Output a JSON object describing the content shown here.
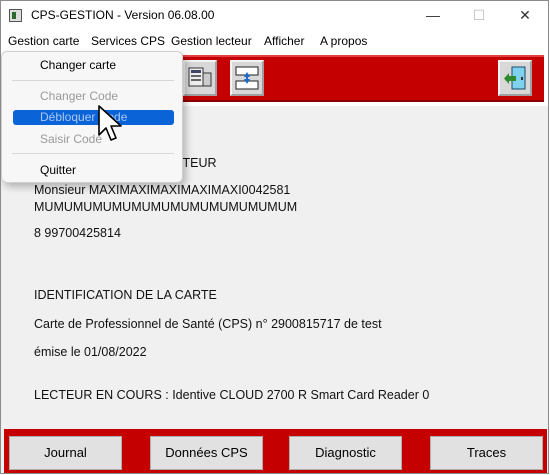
{
  "window": {
    "title": "CPS-GESTION - Version 06.08.00"
  },
  "controls": {
    "minimize": "—",
    "maximize": "☐",
    "close": "✕"
  },
  "menubar": [
    "Gestion carte",
    "Services CPS",
    "Gestion lecteur",
    "Afficher",
    "A propos"
  ],
  "dropdown": {
    "items": [
      {
        "label": "Changer carte",
        "enabled": true
      },
      {
        "label": "Changer Code",
        "enabled": false
      },
      {
        "label": "Débloquer Code",
        "enabled": false,
        "highlighted": true
      },
      {
        "label": "Saisir Code",
        "enabled": false
      },
      {
        "label": "Quitter",
        "enabled": true
      }
    ]
  },
  "toolbar": {
    "icons": [
      "card-reader-icon",
      "transfer-arrows-icon",
      "exit-door-icon"
    ]
  },
  "content": {
    "porteur_heading_fragment": "ORTEUR",
    "holder_name_line1": "Monsieur MAXIMAXIMAXIMAXIMAXI0042581",
    "holder_name_line2": "MUMUMUMUMUMUMUMUMUMUMUMUMUM",
    "holder_id": "8 99700425814",
    "card_heading": "IDENTIFICATION DE LA CARTE",
    "card_desc": "Carte de Professionnel de Santé (CPS) n° 2900815717 de test",
    "card_issue": "émise le 01/08/2022",
    "reader": "LECTEUR EN COURS : Identive CLOUD 2700 R Smart Card Reader 0"
  },
  "buttons": {
    "journal": "Journal",
    "donnees": "Données CPS",
    "diagnostic": "Diagnostic",
    "traces": "Traces"
  },
  "colors": {
    "accent_red": "#c40000",
    "highlight": "#0a64d8"
  }
}
